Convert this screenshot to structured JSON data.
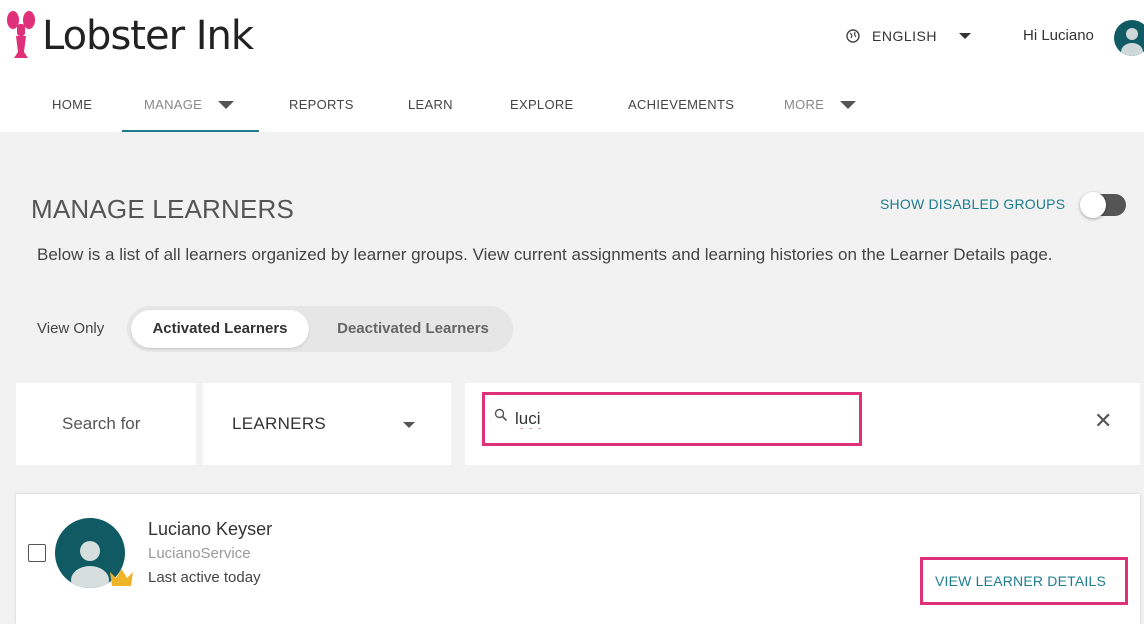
{
  "brand": {
    "name": "Lobster Ink",
    "accent": "#e0307a",
    "teal": "#1e7c8c"
  },
  "header": {
    "language": "ENGLISH",
    "greeting": "Hi Luciano"
  },
  "nav": {
    "items": [
      {
        "label": "HOME"
      },
      {
        "label": "MANAGE"
      },
      {
        "label": "REPORTS"
      },
      {
        "label": "LEARN"
      },
      {
        "label": "EXPLORE"
      },
      {
        "label": "ACHIEVEMENTS"
      },
      {
        "label": "MORE"
      }
    ],
    "active": "MANAGE"
  },
  "main": {
    "title": "MANAGE LEARNERS",
    "show_disabled_label": "SHOW DISABLED GROUPS",
    "description": "Below is a list of all learners organized by learner groups. View current assignments and learning histories on the Learner Details page.",
    "view_only_label": "View Only",
    "filter": {
      "activated": "Activated Learners",
      "deactivated": "Deactivated Learners"
    }
  },
  "search": {
    "search_for_label": "Search for",
    "type_value": "LEARNERS",
    "query": "luci"
  },
  "results": [
    {
      "name": "Luciano Keyser",
      "username": "LucianoService",
      "last_active": "Last active today",
      "action": "VIEW LEARNER DETAILS"
    }
  ],
  "icons": [
    "lobster-logo-icon",
    "globe-icon",
    "chevron-down-icon",
    "avatar-icon",
    "search-icon",
    "close-icon",
    "crown-icon"
  ]
}
